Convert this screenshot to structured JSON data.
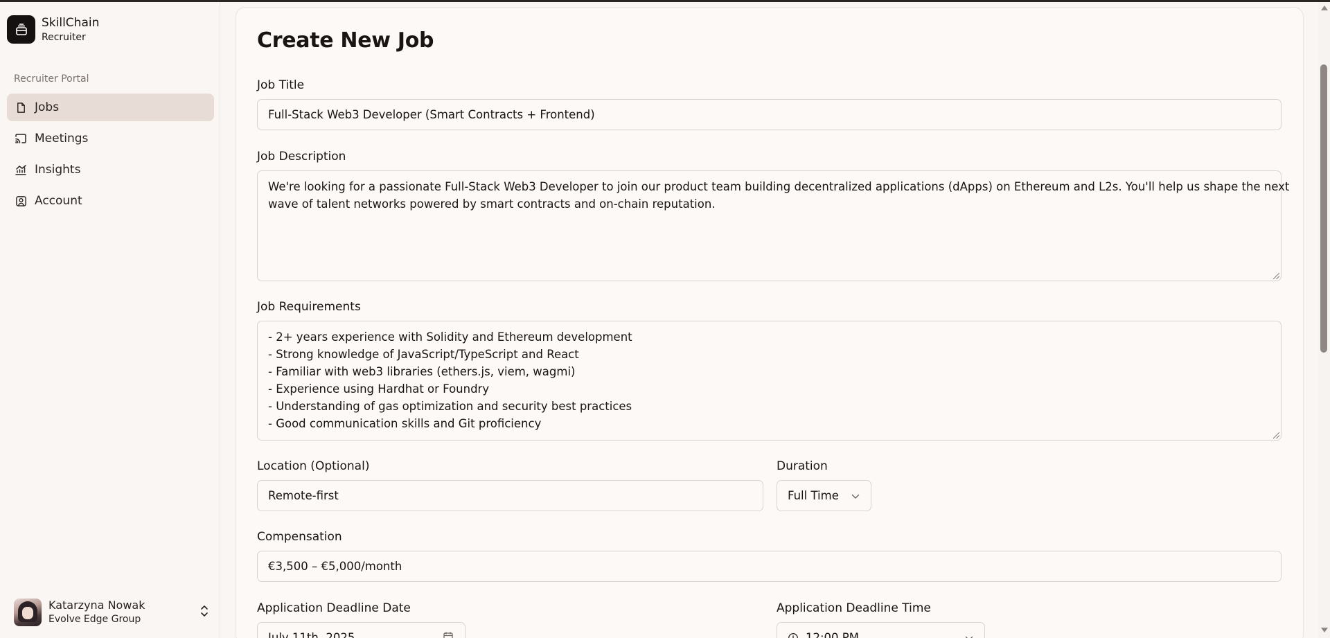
{
  "brand": {
    "name": "SkillChain",
    "role": "Recruiter"
  },
  "sidebar": {
    "section_label": "Recruiter Portal",
    "items": [
      {
        "label": "Jobs",
        "icon": "file-icon",
        "active": true
      },
      {
        "label": "Meetings",
        "icon": "cast-icon",
        "active": false
      },
      {
        "label": "Insights",
        "icon": "chart-icon",
        "active": false
      },
      {
        "label": "Account",
        "icon": "user-square-icon",
        "active": false
      }
    ]
  },
  "user": {
    "name": "Katarzyna Nowak",
    "org": "Evolve Edge Group"
  },
  "form": {
    "title": "Create New Job",
    "job_title": {
      "label": "Job Title",
      "value": "Full-Stack Web3 Developer (Smart Contracts + Frontend)"
    },
    "job_description": {
      "label": "Job Description",
      "lines": [
        "We're looking for a passionate Full-Stack Web3 Developer to join our product team building decentralized applications (dApps) on Ethereum and L2s. You'll help us shape the next",
        "wave of talent networks powered by smart contracts and on-chain reputation."
      ]
    },
    "job_requirements": {
      "label": "Job Requirements",
      "lines": [
        "- 2+ years experience with Solidity and Ethereum development",
        "- Strong knowledge of JavaScript/TypeScript and React",
        "- Familiar with web3 libraries (ethers.js, viem, wagmi)",
        "- Experience using Hardhat or Foundry",
        "- Understanding of gas optimization and security best practices",
        "- Good communication skills and Git proficiency"
      ]
    },
    "location": {
      "label": "Location (Optional)",
      "value": "Remote-first"
    },
    "duration": {
      "label": "Duration",
      "value": "Full Time"
    },
    "compensation": {
      "label": "Compensation",
      "value": "€3,500 – €5,000/month"
    },
    "deadline_date": {
      "label": "Application Deadline Date",
      "value": "July 11th, 2025"
    },
    "deadline_time": {
      "label": "Application Deadline Time",
      "value": "12:00 PM"
    }
  }
}
